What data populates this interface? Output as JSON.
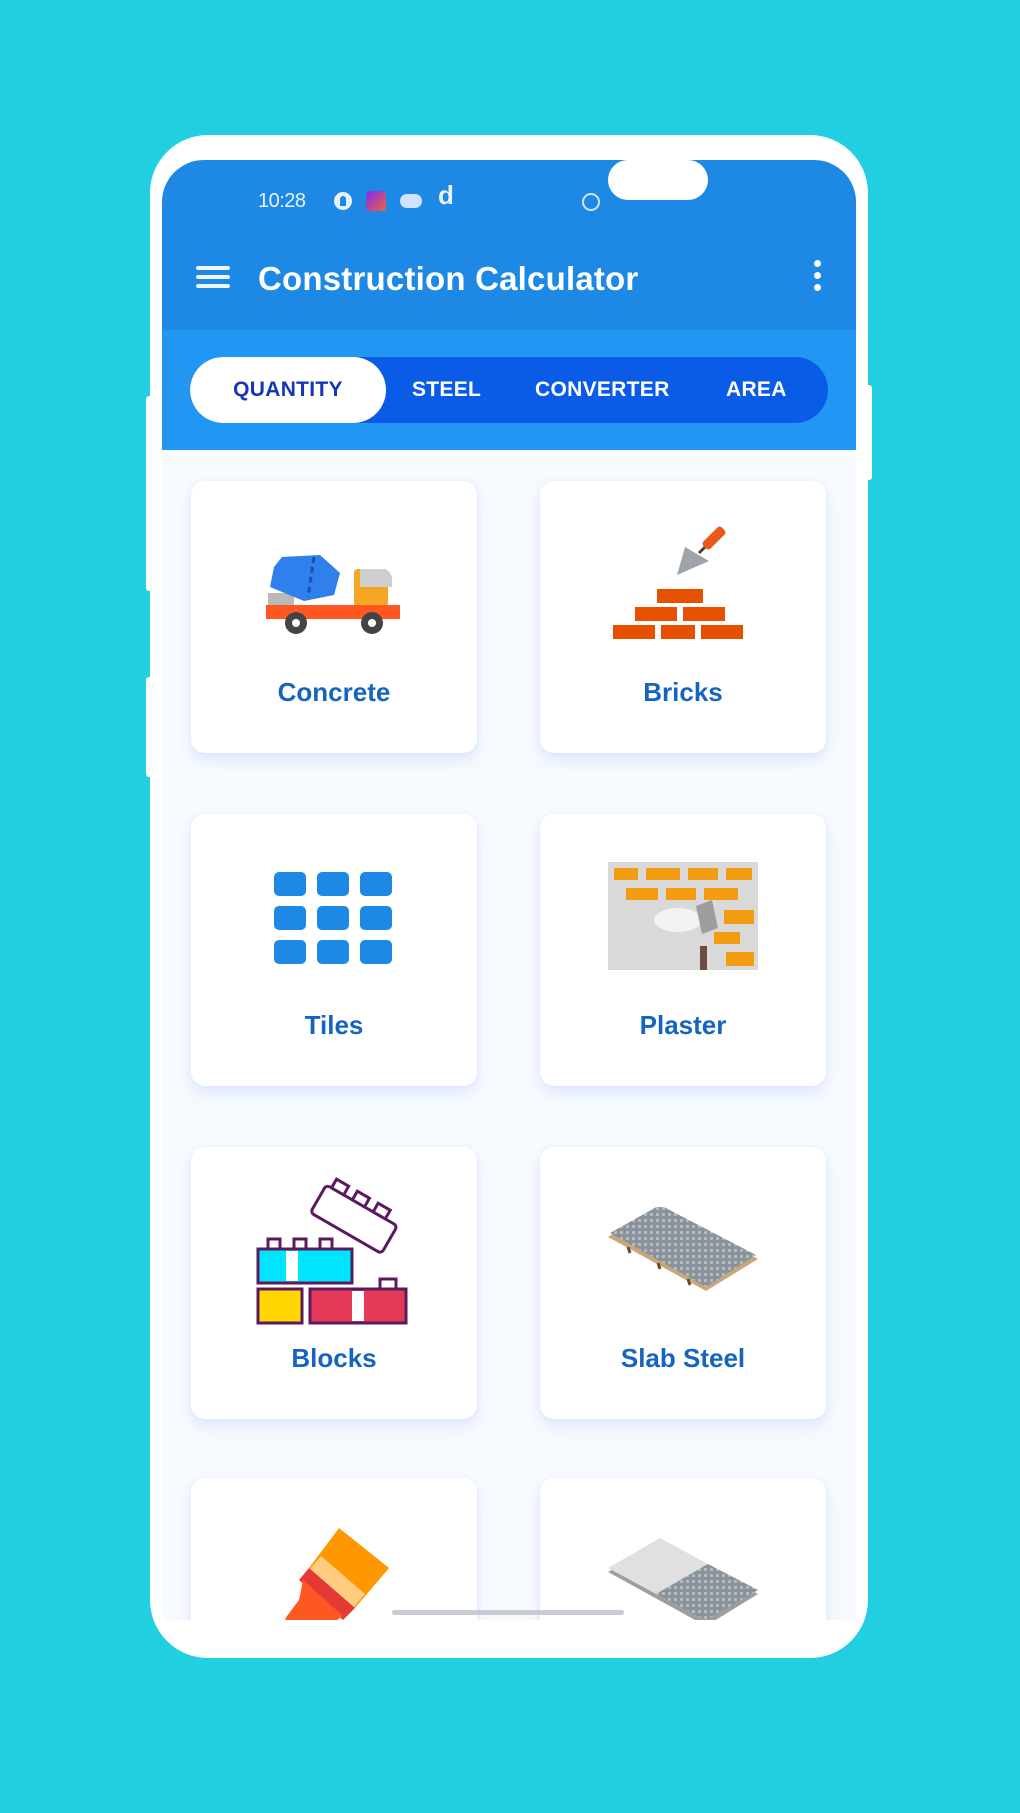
{
  "status_bar": {
    "time": "10:28",
    "icons": [
      "facebook-icon",
      "app-notification-icon",
      "cloud-icon",
      "d-icon",
      "alarm-icon"
    ],
    "d_glyph": "d"
  },
  "app_bar": {
    "title": "Construction Calculator",
    "menu_icon": "hamburger-menu-icon",
    "overflow_icon": "more-vert-icon"
  },
  "tabs": [
    {
      "label": "QUANTITY",
      "active": true
    },
    {
      "label": "STEEL",
      "active": false
    },
    {
      "label": "CONVERTER",
      "active": false
    },
    {
      "label": "AREA",
      "active": false
    }
  ],
  "cards": [
    {
      "label": "Concrete",
      "icon": "concrete-mixer-truck-icon"
    },
    {
      "label": "Bricks",
      "icon": "bricks-trowel-icon"
    },
    {
      "label": "Tiles",
      "icon": "tiles-grid-icon"
    },
    {
      "label": "Plaster",
      "icon": "plaster-wall-icon"
    },
    {
      "label": "Blocks",
      "icon": "blocks-icon"
    },
    {
      "label": "Slab Steel",
      "icon": "slab-steel-mesh-icon"
    },
    {
      "label": "",
      "icon": "paint-brush-icon"
    },
    {
      "label": "",
      "icon": "slab-concrete-icon"
    }
  ],
  "colors": {
    "background": "#22CFE0",
    "app_bar": "#1E88E5",
    "tab_band": "#2196F3",
    "tab_pill": "#0A5BE6",
    "active_tab_text": "#1536B8",
    "card_label": "#1565C0"
  }
}
